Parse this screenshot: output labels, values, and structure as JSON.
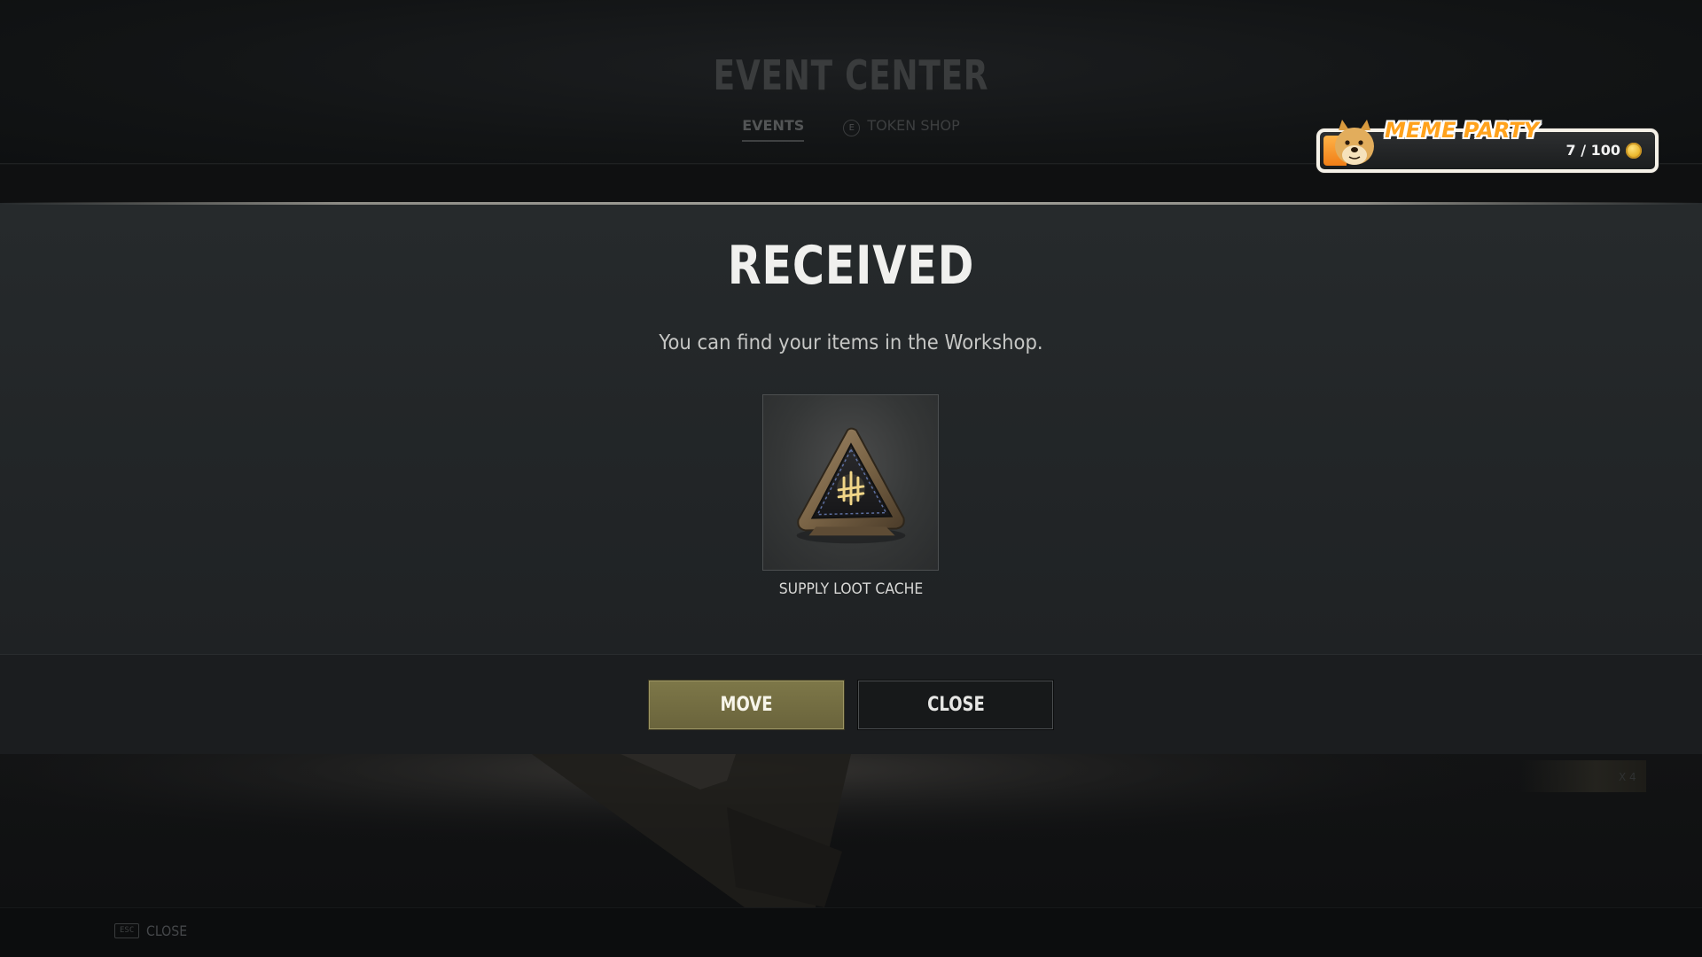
{
  "background": {
    "title": "EVENT CENTER",
    "tabs": [
      {
        "label": "EVENTS",
        "active": true
      },
      {
        "label": "TOKEN SHOP",
        "key_hint": "E",
        "active": false
      }
    ],
    "item_count": "X 4"
  },
  "meme_party": {
    "title": "MEME PARTY",
    "progress_text": "7 / 100",
    "current": 7,
    "max": 100,
    "icon": "doge-icon",
    "coin_icon": "coin-icon",
    "accent_color": "#ffa21c"
  },
  "dialog": {
    "title": "RECEIVED",
    "message": "You can find your items in the Workshop.",
    "item": {
      "name": "SUPPLY LOOT CACHE",
      "icon": "supply-loot-cache-icon"
    },
    "buttons": {
      "move_label": "MOVE",
      "close_label": "CLOSE"
    },
    "colors": {
      "move_button": "#7d7748",
      "close_button": "#17191a"
    }
  },
  "footer": {
    "key": "ESC",
    "label": "CLOSE"
  }
}
